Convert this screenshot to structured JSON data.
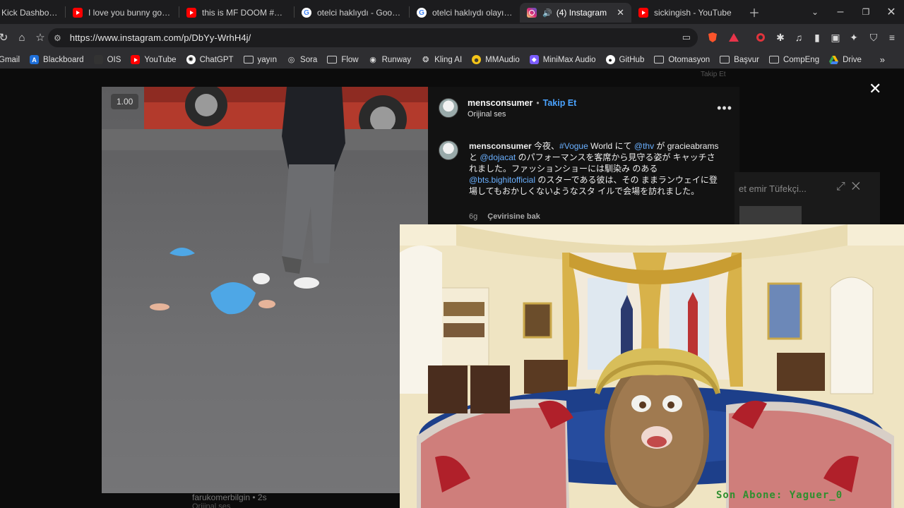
{
  "tabs": [
    {
      "title": "Kick Dashboard",
      "favicon": "kick",
      "active": false
    },
    {
      "title": "I love you bunny go fuck",
      "favicon": "youtube",
      "active": false
    },
    {
      "title": "this is MF DOOM #shorts",
      "favicon": "youtube",
      "active": false
    },
    {
      "title": "otelci haklıydı - Google'd",
      "favicon": "google",
      "active": false
    },
    {
      "title": "otelci haklıydı olayı ne - G",
      "favicon": "google",
      "active": false
    },
    {
      "title": "(4) Instagram",
      "favicon": "instagram",
      "active": true
    },
    {
      "title": "sickingish - YouTube",
      "favicon": "youtube",
      "active": false
    }
  ],
  "address_bar": {
    "url": "https://www.instagram.com/p/DbYy-WrhH4j/"
  },
  "bookmarks": [
    {
      "label": "Gmail",
      "icon": "gmail-icon"
    },
    {
      "label": "Blackboard",
      "icon": "blackboard-icon"
    },
    {
      "label": "OIS",
      "icon": "ois-icon"
    },
    {
      "label": "YouTube",
      "icon": "youtube-icon"
    },
    {
      "label": "ChatGPT",
      "icon": "chatgpt-icon"
    },
    {
      "label": "yayın",
      "icon": "folder-icon"
    },
    {
      "label": "Sora",
      "icon": "sora-icon"
    },
    {
      "label": "Flow",
      "icon": "folder-icon"
    },
    {
      "label": "Runway",
      "icon": "runway-icon"
    },
    {
      "label": "Kling AI",
      "icon": "kling-icon"
    },
    {
      "label": "MMAudio",
      "icon": "mmaudio-icon"
    },
    {
      "label": "MiniMax Audio",
      "icon": "minimax-icon"
    },
    {
      "label": "GitHub",
      "icon": "github-icon"
    },
    {
      "label": "Otomasyon",
      "icon": "folder-icon"
    },
    {
      "label": "Başvur",
      "icon": "folder-icon"
    },
    {
      "label": "CompEng",
      "icon": "folder-icon"
    },
    {
      "label": "Drive",
      "icon": "drive-icon"
    }
  ],
  "video": {
    "speed": "1.00"
  },
  "post": {
    "username": "mensconsumer",
    "separator": "•",
    "follow_label": "Takip Et",
    "audio": "Orijinal ses",
    "caption_user": "mensconsumer",
    "caption_parts": [
      {
        "text": " 今夜、",
        "mention": false
      },
      {
        "text": "#Vogue",
        "mention": true
      },
      {
        "text": " World にて ",
        "mention": false
      },
      {
        "text": "@thv",
        "mention": true
      },
      {
        "text": " が gracieabrams と ",
        "mention": false
      },
      {
        "text": "@dojacat",
        "mention": true
      },
      {
        "text": " のパフォーマンスを客席から見守る姿が キャッチされました。ファッションショーには馴染み のある ",
        "mention": false
      },
      {
        "text": "@bts.bighitofficial",
        "mention": true
      },
      {
        "text": " のスターである彼は、その ままランウェイに登場してもおかしくないようなスタ イルで会場を訪れました。",
        "mention": false
      }
    ],
    "time": "6g",
    "translate_label": "Çevirisine bak"
  },
  "background_overlay": {
    "ghost_title": "et emir Tüfekçi...",
    "ghost_follow": "Takip Et",
    "bottom_user": "farukomerbilgin • 2s",
    "bottom_sub": "Orijinal ses"
  },
  "pip": {
    "ticker": "Son Abone: Yaguer_0"
  },
  "colors": {
    "accent_link": "#4aa3ff",
    "tab_bg": "#1c1c1e",
    "toolbar_bg": "#2e2e31",
    "page_bg": "#0c0c0c"
  }
}
